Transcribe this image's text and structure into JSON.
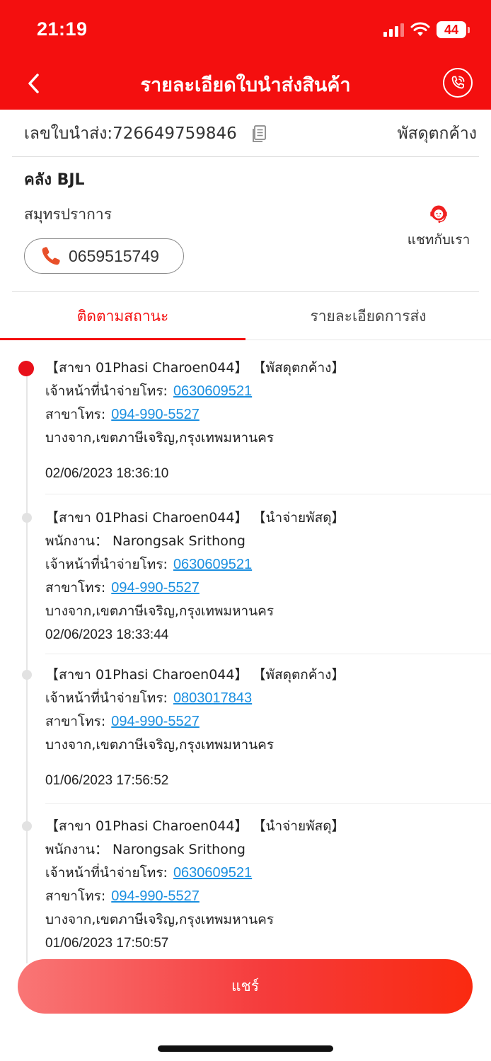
{
  "status_bar": {
    "time": "21:19",
    "battery": "44"
  },
  "header": {
    "title": "รายละเอียดใบนำส่งสินค้า"
  },
  "waybill": {
    "label": "เลขใบนำส่ง:726649759846",
    "status": "พัสดุตกค้าง"
  },
  "warehouse": {
    "name": "คลัง BJL",
    "province": "สมุทรปราการ",
    "phone": "0659515749",
    "chat_label": "แชทกับเรา"
  },
  "tabs": [
    {
      "label": "ติดตามสถานะ",
      "active": true
    },
    {
      "label": "รายละเอียดการส่ง",
      "active": false
    }
  ],
  "events": [
    {
      "title": "【สาขา 01Phasi Charoen044】 【พัสดุตกค้าง】",
      "courier_label": "เจ้าหน้าที่นำจ่ายโทร:",
      "courier_phone": "0630609521",
      "branch_label": "สาขาโทร:",
      "branch_phone": "094-990-5527",
      "location": " บางจาก,เขตภาษีเจริญ,กรุงเทพมหานคร",
      "time": "02/06/2023 18:36:10"
    },
    {
      "title": "【สาขา 01Phasi Charoen044】 【นำจ่ายพัสดุ】",
      "staff": "พนักงาน： Narongsak Srithong",
      "courier_label": "เจ้าหน้าที่นำจ่ายโทร:",
      "courier_phone": "0630609521",
      "branch_label": "สาขาโทร:",
      "branch_phone": "094-990-5527",
      "location": " บางจาก,เขตภาษีเจริญ,กรุงเทพมหานคร",
      "time": "02/06/2023 18:33:44"
    },
    {
      "title": "【สาขา 01Phasi Charoen044】 【พัสดุตกค้าง】",
      "courier_label": "เจ้าหน้าที่นำจ่ายโทร:",
      "courier_phone": "0803017843",
      "branch_label": "สาขาโทร:",
      "branch_phone": "094-990-5527",
      "location": " บางจาก,เขตภาษีเจริญ,กรุงเทพมหานคร",
      "time": "01/06/2023 17:56:52"
    },
    {
      "title": "【สาขา 01Phasi Charoen044】 【นำจ่ายพัสดุ】",
      "staff": "พนักงาน： Narongsak Srithong",
      "courier_label": "เจ้าหน้าที่นำจ่ายโทร:",
      "courier_phone": "0630609521",
      "branch_label": "สาขาโทร:",
      "branch_phone": "094-990-5527",
      "location": " บางจาก,เขตภาษีเจริญ,กรุงเทพมหานคร",
      "time": "01/06/2023 17:50:57"
    }
  ],
  "share_button": {
    "label": "แชร์"
  },
  "colors": {
    "brand_red": "#f40f0f",
    "link_blue": "#1a8fe0",
    "dot_active": "#e8101a",
    "dot_inactive": "#e2e2e2"
  },
  "icons": [
    "back-chevron-icon",
    "phone-call-icon",
    "copy-icon",
    "phone-handset-icon",
    "customer-service-icon",
    "signal-icon",
    "wifi-icon",
    "battery-icon"
  ]
}
